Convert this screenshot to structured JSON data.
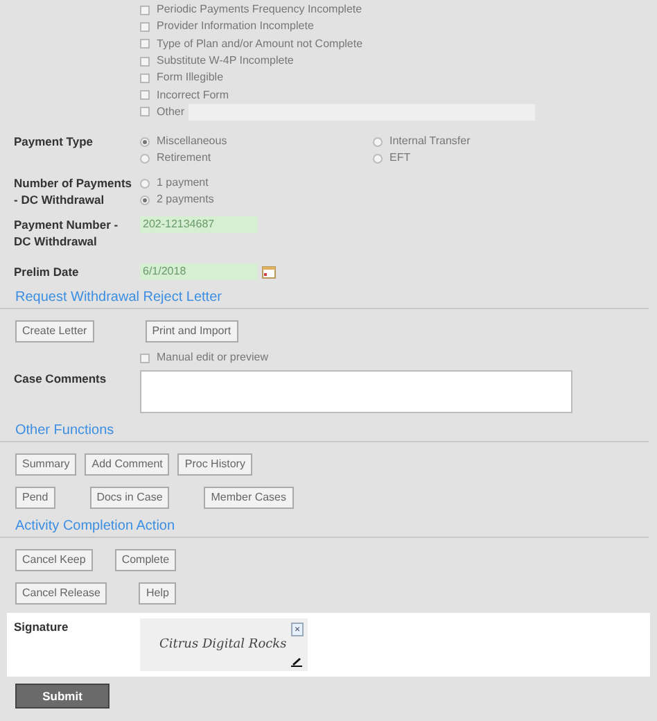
{
  "reasons": [
    {
      "label": "Periodic Payments Frequency Incomplete",
      "checked": false
    },
    {
      "label": "Provider Information Incomplete",
      "checked": false
    },
    {
      "label": "Type of Plan and/or Amount not Complete",
      "checked": false
    },
    {
      "label": "Substitute W-4P Incomplete",
      "checked": false
    },
    {
      "label": "Form Illegible",
      "checked": false
    },
    {
      "label": "Incorrect Form",
      "checked": false
    },
    {
      "label": "Other",
      "checked": false,
      "has_field": true
    }
  ],
  "payment_type": {
    "label": "Payment Type",
    "options": [
      {
        "label": "Miscellaneous",
        "selected": true
      },
      {
        "label": "Internal Transfer",
        "selected": false
      },
      {
        "label": "Retirement",
        "selected": false
      },
      {
        "label": "EFT",
        "selected": false
      }
    ]
  },
  "number_of_payments": {
    "label": "Number of Payments - DC Withdrawal",
    "options": [
      {
        "label": "1 payment",
        "selected": false
      },
      {
        "label": "2 payments",
        "selected": true
      }
    ]
  },
  "payment_number": {
    "label": "Payment Number - DC Withdrawal",
    "value": "202-12134687"
  },
  "prelim_date": {
    "label": "Prelim Date",
    "value": "6/1/2018"
  },
  "sections": [
    {
      "title": "Request Withdrawal Reject Letter",
      "button_rows": [
        [
          "Create Letter",
          "Print and Import"
        ]
      ]
    },
    {
      "title": "Other Functions",
      "button_rows": [
        [
          "Summary",
          "Add Comment",
          "Proc History"
        ],
        [
          "Pend",
          "Docs in Case",
          "Member Cases"
        ]
      ]
    },
    {
      "title": "Activity Completion Action",
      "button_rows": [
        [
          "Cancel Keep",
          "Complete"
        ],
        [
          "Cancel Release",
          "Help"
        ]
      ]
    }
  ],
  "manual_edit": {
    "label": "Manual edit or preview",
    "checked": false
  },
  "case_comments": {
    "label": "Case Comments"
  },
  "signature": {
    "label": "Signature",
    "value": "Citrus Digital Rocks",
    "clear": "×"
  },
  "submit": "Submit"
}
